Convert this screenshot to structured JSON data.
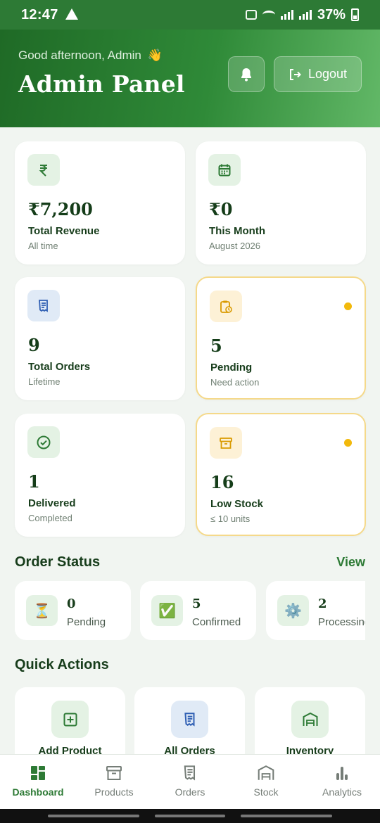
{
  "status_bar": {
    "time": "12:47",
    "battery": "37%"
  },
  "header": {
    "greeting": "Good afternoon, Admin",
    "greeting_emoji": "👋",
    "title": "Admin Panel",
    "logout_label": "Logout"
  },
  "stats": [
    {
      "icon": "rupee-icon",
      "value": "₹7,200",
      "label": "Total Revenue",
      "sub": "All time"
    },
    {
      "icon": "calendar-icon",
      "value": "₹0",
      "label": "This Month",
      "sub": "August 2026"
    },
    {
      "icon": "receipt-icon",
      "value": "9",
      "label": "Total Orders",
      "sub": "Lifetime"
    },
    {
      "icon": "clipboard-clock-icon",
      "value": "5",
      "label": "Pending",
      "sub": "Need action"
    },
    {
      "icon": "check-circle-icon",
      "value": "1",
      "label": "Delivered",
      "sub": "Completed"
    },
    {
      "icon": "archive-box-icon",
      "value": "16",
      "label": "Low Stock",
      "sub": "≤ 10 units"
    }
  ],
  "order_status": {
    "title": "Order Status",
    "link": "View",
    "items": [
      {
        "icon": "hourglass-icon",
        "glyph": "⏳",
        "count": "0",
        "label": "Pending"
      },
      {
        "icon": "check-box-icon",
        "glyph": "✅",
        "count": "5",
        "label": "Confirmed"
      },
      {
        "icon": "gear-icon",
        "glyph": "⚙️",
        "count": "2",
        "label": "Processing"
      }
    ]
  },
  "quick_actions": {
    "title": "Quick Actions",
    "items": [
      {
        "icon": "plus-square-icon",
        "label": "Add Product"
      },
      {
        "icon": "receipt-icon",
        "label": "All Orders"
      },
      {
        "icon": "warehouse-icon",
        "label": "Inventory"
      }
    ]
  },
  "bottom_nav": [
    {
      "icon": "dashboard-icon",
      "label": "Dashboard",
      "active": true
    },
    {
      "icon": "box-icon",
      "label": "Products",
      "active": false
    },
    {
      "icon": "receipt-icon",
      "label": "Orders",
      "active": false
    },
    {
      "icon": "warehouse-icon",
      "label": "Stock",
      "active": false
    },
    {
      "icon": "bar-chart-icon",
      "label": "Analytics",
      "active": false
    }
  ],
  "colors": {
    "brand": "#2d7a35",
    "alert_border": "#f5d98a",
    "alert_dot": "#f2b90c",
    "background": "#f1f5f1"
  }
}
